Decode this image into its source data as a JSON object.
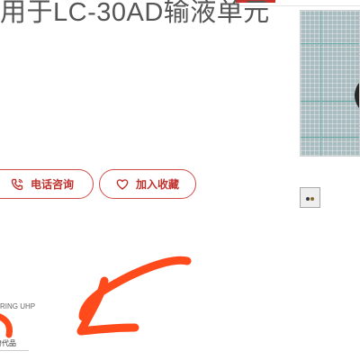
{
  "product": {
    "title": "用于LC-30AD输液单元"
  },
  "actions": {
    "phone_label": "电话咨询",
    "favorite_label": "加入收藏"
  },
  "details": {
    "spec_label": "RING UHP",
    "tag_label": "替代品"
  },
  "colors": {
    "accent": "#c0312d",
    "annotation": "#ff4a1c"
  },
  "icons": {
    "phone": "phone-icon",
    "favorite": "heart-icon"
  }
}
